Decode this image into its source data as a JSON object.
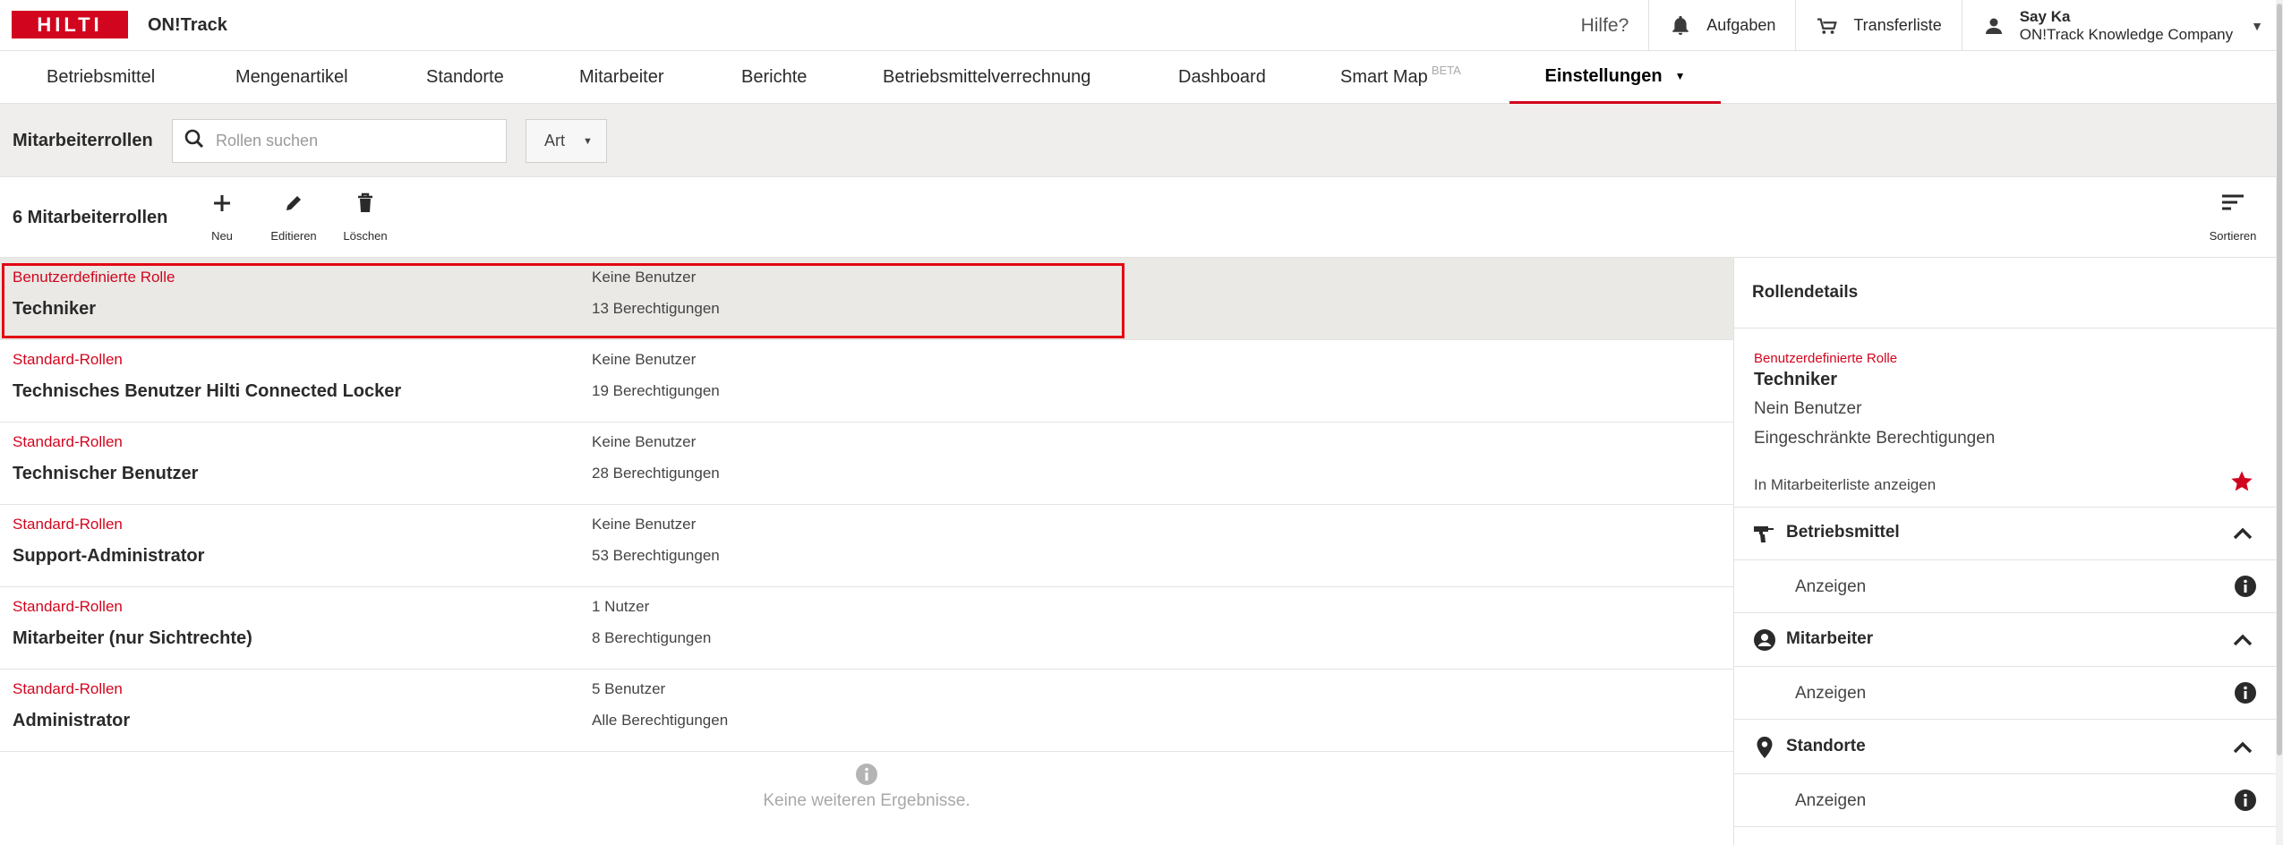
{
  "header": {
    "logo_text": "HILTI",
    "app_name": "ON!Track",
    "help_label": "Hilfe?",
    "tasks_label": "Aufgaben",
    "transfer_label": "Transferliste",
    "user_name": "Say Ka",
    "user_company": "ON!Track Knowledge Company"
  },
  "nav": {
    "items": [
      {
        "label": "Betriebsmittel"
      },
      {
        "label": "Mengenartikel"
      },
      {
        "label": "Standorte"
      },
      {
        "label": "Mitarbeiter"
      },
      {
        "label": "Berichte"
      },
      {
        "label": "Betriebsmittelverrechnung"
      },
      {
        "label": "Dashboard"
      },
      {
        "label": "Smart Map",
        "badge": "BETA"
      },
      {
        "label": "Einstellungen",
        "active": true
      }
    ]
  },
  "filter": {
    "title": "Mitarbeiterrollen",
    "search_placeholder": "Rollen suchen",
    "type_select": "Art"
  },
  "toolbar": {
    "count_title": "6 Mitarbeiterrollen",
    "new_label": "Neu",
    "edit_label": "Editieren",
    "delete_label": "Löschen",
    "sort_label": "Sortieren"
  },
  "roles": [
    {
      "type": "Benutzerdefinierte Rolle",
      "name": "Techniker",
      "users": "Keine Benutzer",
      "permissions": "13 Berechtigungen",
      "selected": true
    },
    {
      "type": "Standard-Rollen",
      "name": "Technisches Benutzer Hilti Connected Locker",
      "users": "Keine Benutzer",
      "permissions": "19 Berechtigungen"
    },
    {
      "type": "Standard-Rollen",
      "name": "Technischer Benutzer",
      "users": "Keine Benutzer",
      "permissions": "28 Berechtigungen"
    },
    {
      "type": "Standard-Rollen",
      "name": "Support-Administrator",
      "users": "Keine Benutzer",
      "permissions": "53 Berechtigungen"
    },
    {
      "type": "Standard-Rollen",
      "name": "Mitarbeiter (nur Sichtrechte)",
      "users": "1 Nutzer",
      "permissions": "8 Berechtigungen"
    },
    {
      "type": "Standard-Rollen",
      "name": "Administrator",
      "users": "5 Benutzer",
      "permissions": "Alle Berechtigungen"
    }
  ],
  "list_footer": "Keine weiteren Ergebnisse.",
  "details": {
    "title": "Rollendetails",
    "type": "Benutzerdefinierte Rolle",
    "name": "Techniker",
    "users": "Nein Benutzer",
    "permissions": "Eingeschränkte Berechtigungen",
    "show_in_list": "In Mitarbeiterliste anzeigen",
    "sections": [
      {
        "title": "Betriebsmittel",
        "icon": "drill-icon",
        "sub": "Anzeigen"
      },
      {
        "title": "Mitarbeiter",
        "icon": "person-circle-icon",
        "sub": "Anzeigen"
      },
      {
        "title": "Standorte",
        "icon": "location-pin-icon",
        "sub": "Anzeigen"
      }
    ]
  },
  "colors": {
    "brand_red": "#d2051e",
    "selected_row": "#eae9e6",
    "filter_bg": "#efeeec"
  }
}
